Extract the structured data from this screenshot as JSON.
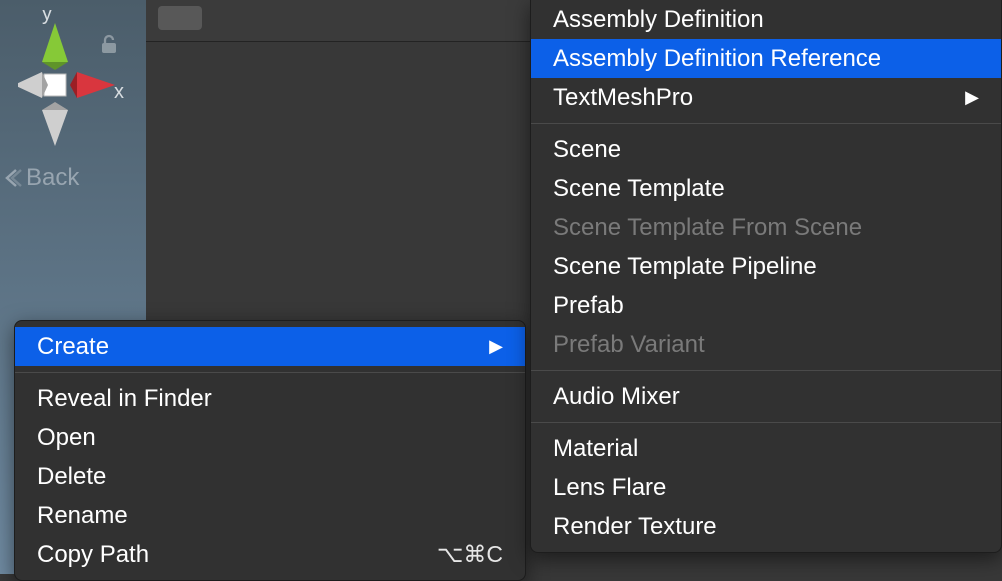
{
  "scene": {
    "axis_x": "x",
    "axis_y": "y",
    "back_label": "Back"
  },
  "context_menu": {
    "items": [
      {
        "label": "Create",
        "highlighted": true,
        "submenu": true
      },
      {
        "_sep": true
      },
      {
        "label": "Reveal in Finder"
      },
      {
        "label": "Open"
      },
      {
        "label": "Delete"
      },
      {
        "label": "Rename"
      },
      {
        "label": "Copy Path",
        "shortcut": "⌥⌘C"
      }
    ]
  },
  "create_submenu": {
    "items": [
      {
        "label": "Assembly Definition"
      },
      {
        "label": "Assembly Definition Reference",
        "highlighted": true
      },
      {
        "label": "TextMeshPro",
        "submenu": true
      },
      {
        "_sep": true
      },
      {
        "label": "Scene"
      },
      {
        "label": "Scene Template"
      },
      {
        "label": "Scene Template From Scene",
        "disabled": true
      },
      {
        "label": "Scene Template Pipeline"
      },
      {
        "label": "Prefab"
      },
      {
        "label": "Prefab Variant",
        "disabled": true
      },
      {
        "_sep": true
      },
      {
        "label": "Audio Mixer"
      },
      {
        "_sep": true
      },
      {
        "label": "Material"
      },
      {
        "label": "Lens Flare"
      },
      {
        "label": "Render Texture"
      }
    ]
  }
}
